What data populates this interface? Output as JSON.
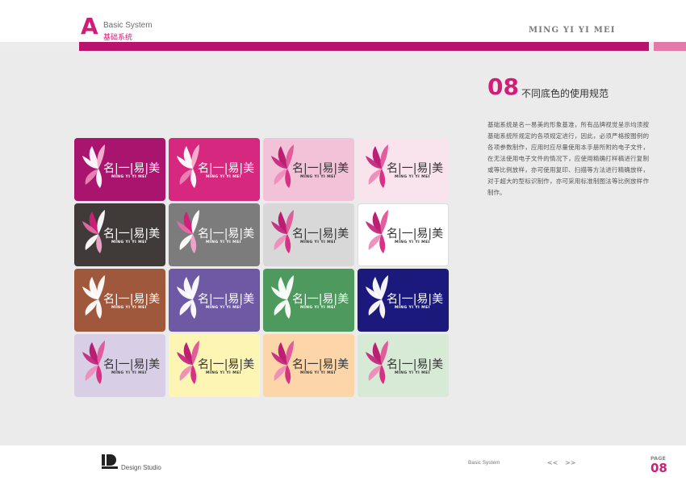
{
  "header": {
    "section_letter": "A",
    "section_en": "Basic System",
    "section_zh": "基础系统",
    "brand": "MING YI YI MEI"
  },
  "colors": {
    "accent": "#d11d78",
    "bar": "#b8146e",
    "bar_pink": "#e47aa9"
  },
  "section": {
    "number": "08",
    "title": "不同底色的使用规范",
    "body": "基础系统是名一易美的形象基准，所有品牌视觉呈示均须按基础系统所规定的各项规定进行，因此，必须严格按图例的各项参数制作，应用时应尽量使用本手册所附的电子文件，在无法使用电子文件的情况下，应使用精确打样稿进行复制或等比例放样，亦可使用复印、扫描等方法进行精确放样，对于超大的型标识制作，亦可采用标准制图法等比例放样作制作。"
  },
  "logo": {
    "cn": "名|一|易|美",
    "en": "MING YI YI MEI"
  },
  "cards": [
    {
      "bg": "#a8146e",
      "text": "#ffffff",
      "petals": "white-pink"
    },
    {
      "bg": "#d6287f",
      "text": "#ffffff",
      "petals": "white-pink"
    },
    {
      "bg": "#f2c2d8",
      "text": "#333333",
      "petals": "magenta"
    },
    {
      "bg": "#f9e4ee",
      "text": "#333333",
      "petals": "magenta"
    },
    {
      "bg": "#403a38",
      "text": "#ffffff",
      "petals": "magenta-white"
    },
    {
      "bg": "#7c7c7c",
      "text": "#ffffff",
      "petals": "magenta-white"
    },
    {
      "bg": "#d8d8d8",
      "text": "#333333",
      "petals": "magenta"
    },
    {
      "bg": "#ffffff",
      "text": "#333333",
      "petals": "magenta"
    },
    {
      "bg": "#a0583c",
      "text": "#ffffff",
      "petals": "white"
    },
    {
      "bg": "#6e5aa4",
      "text": "#ffffff",
      "petals": "white"
    },
    {
      "bg": "#4e9a5e",
      "text": "#ffffff",
      "petals": "white"
    },
    {
      "bg": "#1b1a7c",
      "text": "#ffffff",
      "petals": "white"
    },
    {
      "bg": "#d8cfe6",
      "text": "#333333",
      "petals": "magenta"
    },
    {
      "bg": "#fcf5b4",
      "text": "#333333",
      "petals": "magenta"
    },
    {
      "bg": "#fcd6a8",
      "text": "#333333",
      "petals": "magenta"
    },
    {
      "bg": "#d6ead6",
      "text": "#333333",
      "petals": "magenta"
    }
  ],
  "footer": {
    "studio": "Design Studio",
    "basic": "Basic System",
    "prev": "<<",
    "next": ">>",
    "page_label": "PAGE",
    "page_number": "08"
  }
}
